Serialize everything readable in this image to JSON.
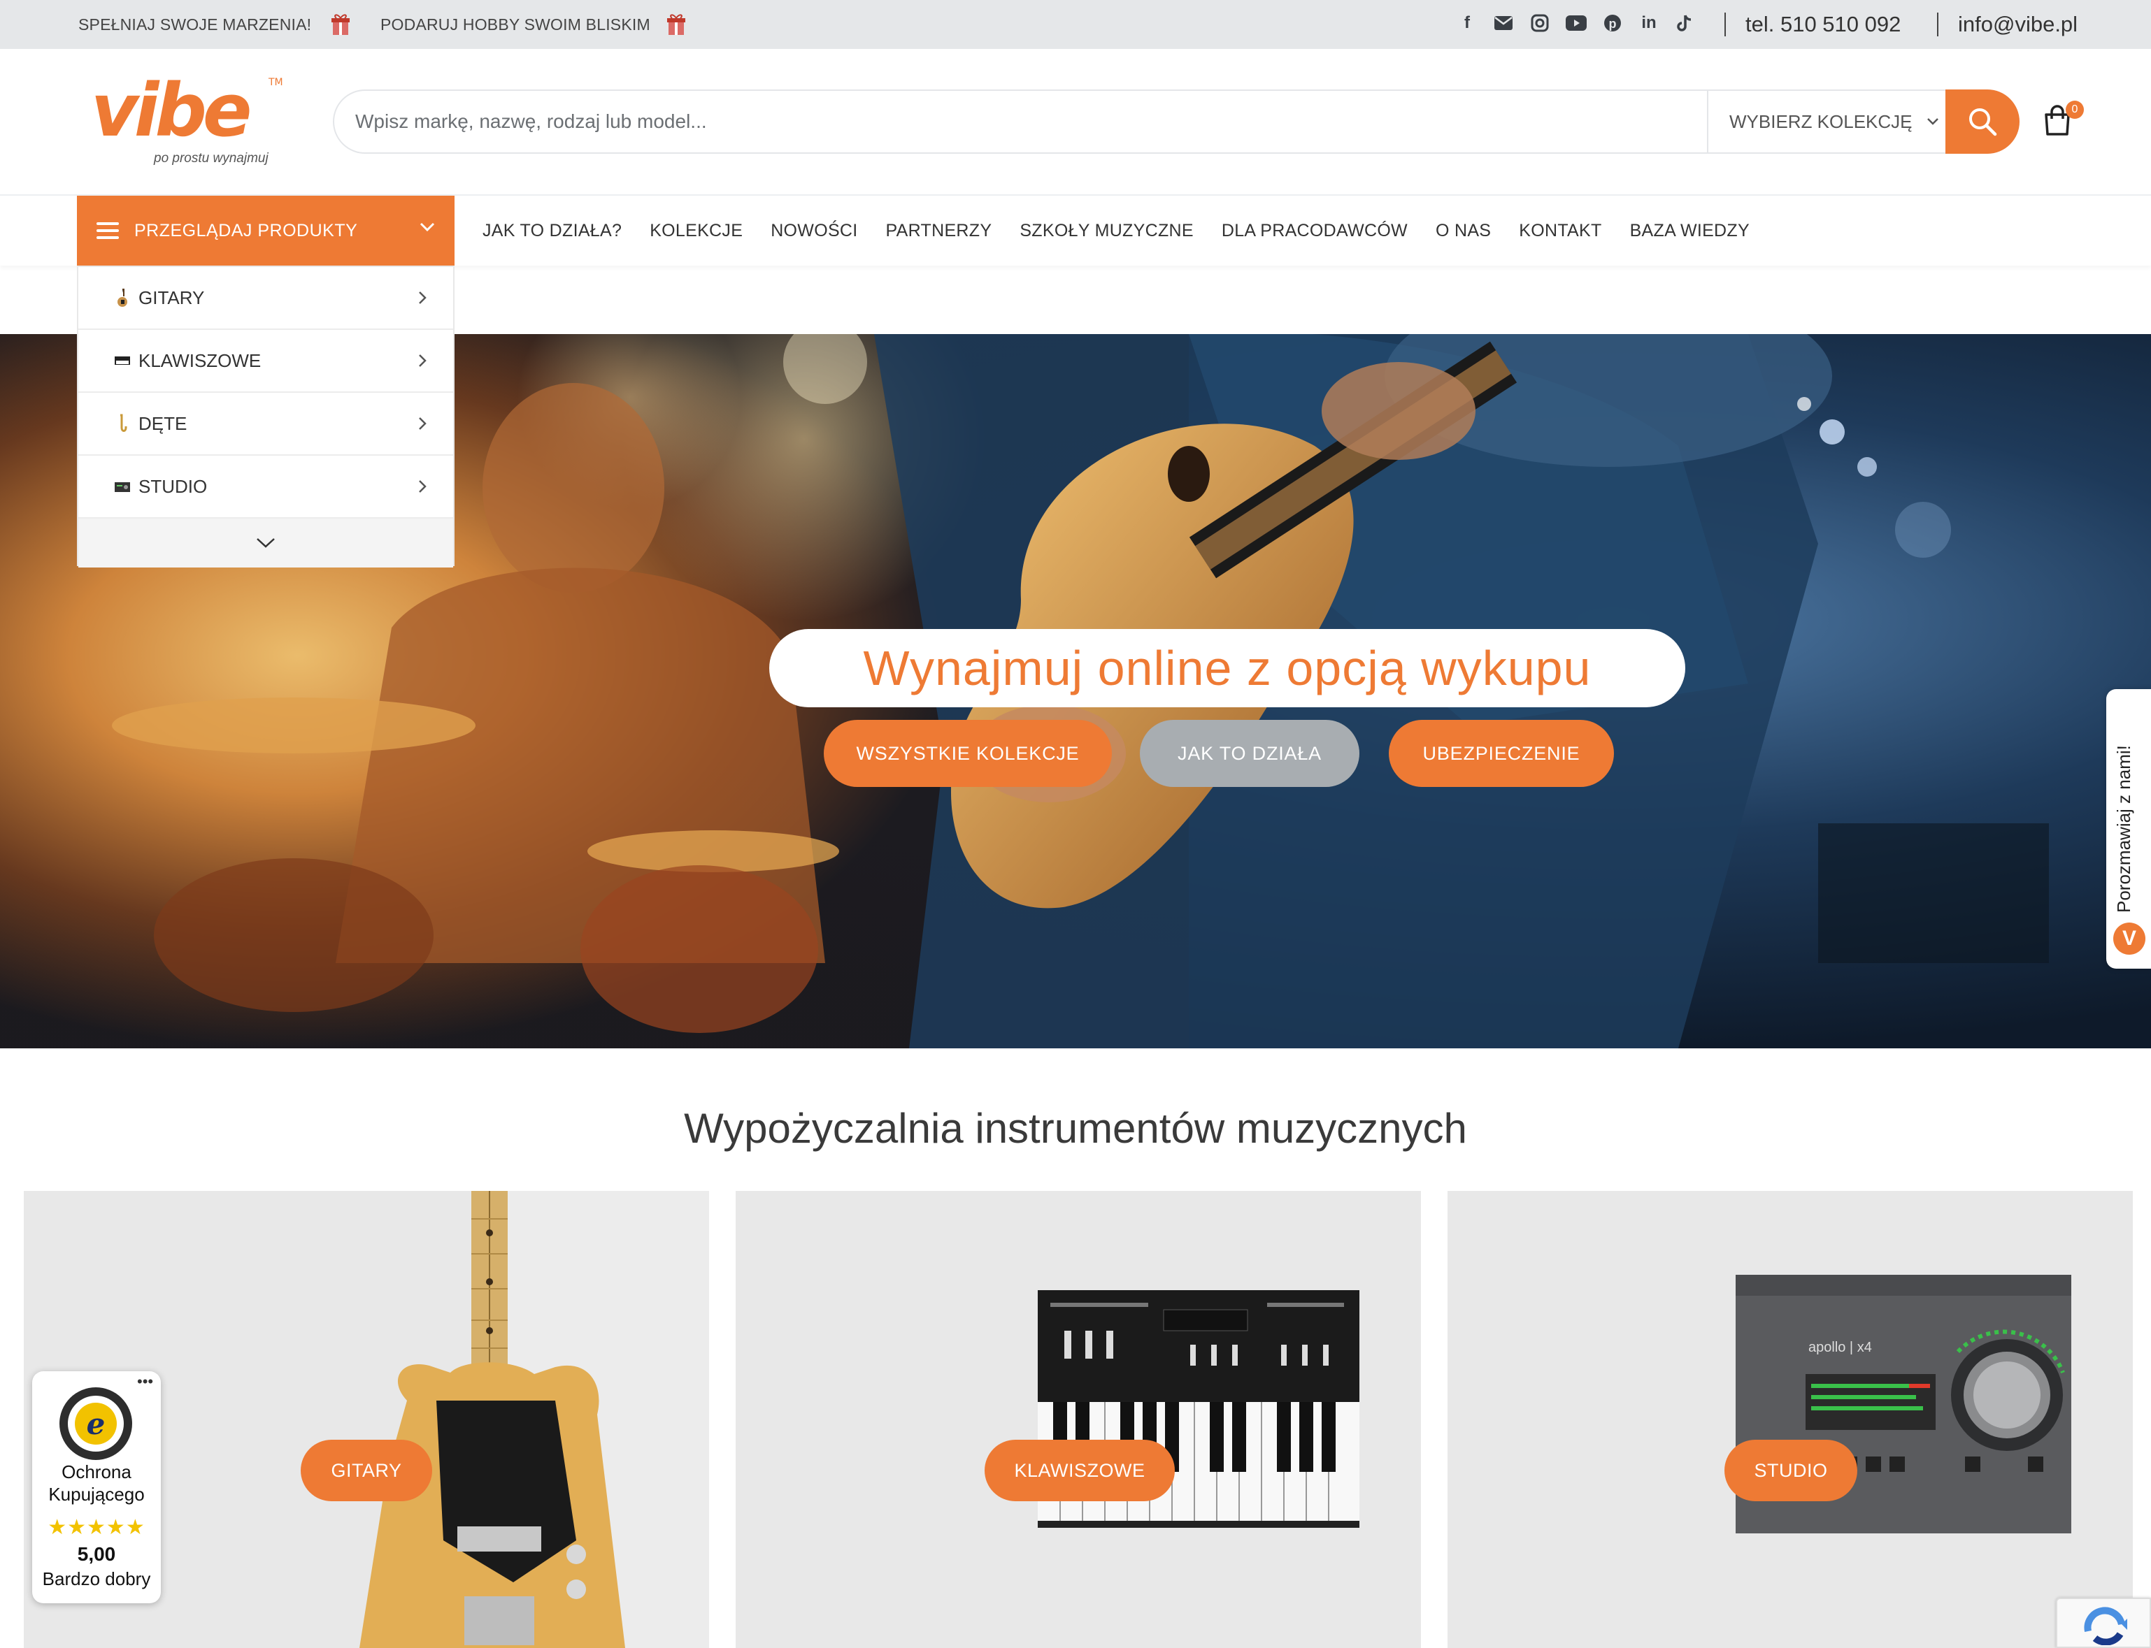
{
  "topbar": {
    "promo1": "SPEŁNIAJ SWOJE MARZENIA!",
    "promo2": "PODARUJ HOBBY SWOIM BLISKIM",
    "socials": [
      "facebook-icon",
      "email-icon",
      "instagram-icon",
      "youtube-icon",
      "pinterest-icon",
      "linkedin-icon",
      "tiktok-icon"
    ],
    "phone": "tel. 510 510 092",
    "email": "info@vibe.pl"
  },
  "header": {
    "logo_text": "vibe",
    "logo_tm": "TM",
    "tagline": "po prostu wynajmuj",
    "search_placeholder": "Wpisz markę, nazwę, rodzaj lub model...",
    "collection_select": "WYBIERZ KOLEKCJĘ",
    "cart_count": "0"
  },
  "nav": {
    "browse_label": "PRZEGLĄDAJ PRODUKTY",
    "links": [
      "JAK TO DZIAŁA?",
      "KOLEKCJE",
      "NOWOŚCI",
      "PARTNERZY",
      "SZKOŁY MUZYCZNE",
      "DLA PRACODAWCÓW",
      "O NAS",
      "KONTAKT",
      "BAZA WIEDZY"
    ]
  },
  "categories": [
    {
      "label": "GITARY",
      "icon": "guitar-icon"
    },
    {
      "label": "KLAWISZOWE",
      "icon": "keyboard-icon"
    },
    {
      "label": "DĘTE",
      "icon": "saxophone-icon"
    },
    {
      "label": "STUDIO",
      "icon": "audio-interface-icon"
    }
  ],
  "hero": {
    "title": "Wynajmuj online z opcją wykupu",
    "buttons": [
      "WSZYSTKIE KOLEKCJE",
      "JAK TO DZIAŁA",
      "UBEZPIECZENIE"
    ]
  },
  "chat": {
    "label": "Porozmawiaj z nami!",
    "logo_letter": "V"
  },
  "section": {
    "title": "Wypożyczalnia instrumentów muzycznych",
    "cards": [
      "GITARY",
      "KLAWISZOWE",
      "STUDIO"
    ],
    "apollo_label": "apollo | x4"
  },
  "trust": {
    "line1": "Ochrona",
    "line2": "Kupującego",
    "stars": "★★★★★",
    "score": "5,00",
    "grade": "Bardzo dobry",
    "menu": "•••"
  },
  "colors": {
    "accent": "#ee7a34",
    "gray_button": "#a8adb1",
    "topbar": "#e5e7e9"
  }
}
